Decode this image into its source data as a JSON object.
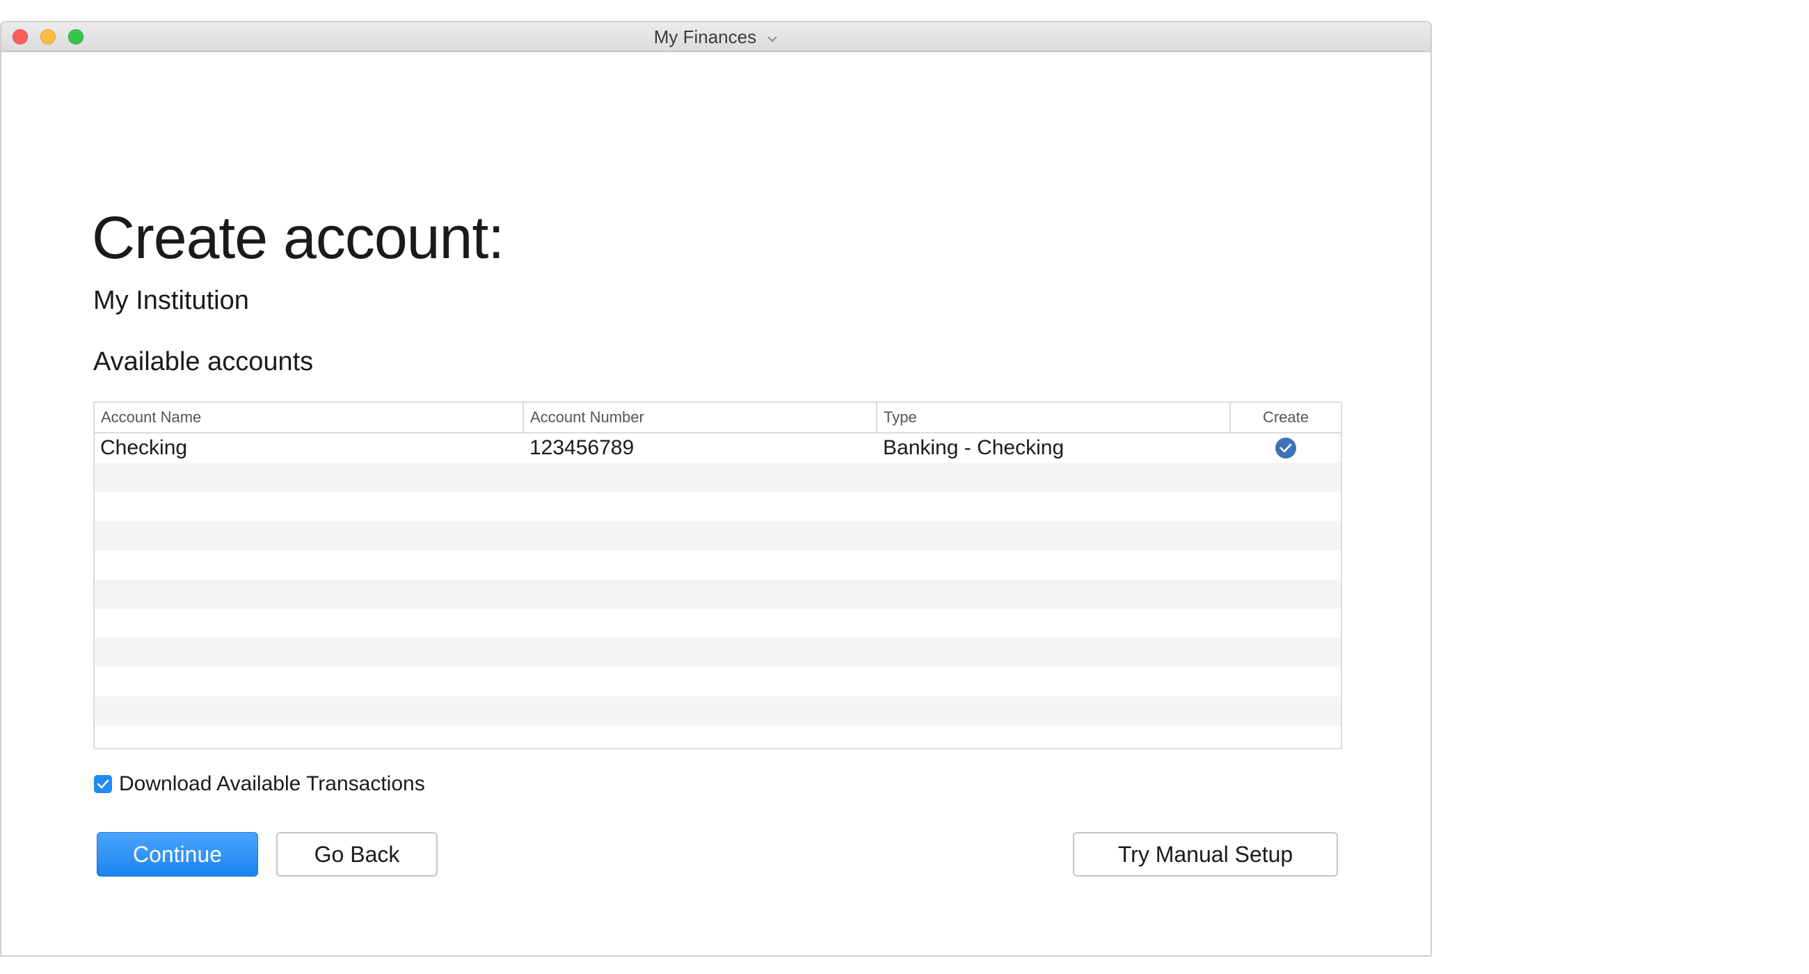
{
  "window": {
    "title": "My Finances"
  },
  "page": {
    "title": "Create account:",
    "institution": "My Institution",
    "section_label": "Available accounts"
  },
  "table": {
    "headers": {
      "account_name": "Account Name",
      "account_number": "Account Number",
      "type": "Type",
      "create": "Create"
    },
    "rows": [
      {
        "account_name": "Checking",
        "account_number": "123456789",
        "type": "Banking - Checking",
        "create": true
      }
    ]
  },
  "options": {
    "download_transactions_label": "Download Available Transactions",
    "download_transactions_checked": true
  },
  "buttons": {
    "continue": "Continue",
    "go_back": "Go Back",
    "manual_setup": "Try Manual Setup"
  },
  "colors": {
    "primary_button": "#1c84f0",
    "checkbox": "#1f8bf2",
    "create_check": "#3f73b9",
    "row_stripe": "#f5f5f5"
  },
  "icons": {
    "title_dropdown": "chevron-down-icon",
    "create_checked": "check-circle-icon",
    "checkbox_checked": "checkmark-icon"
  }
}
